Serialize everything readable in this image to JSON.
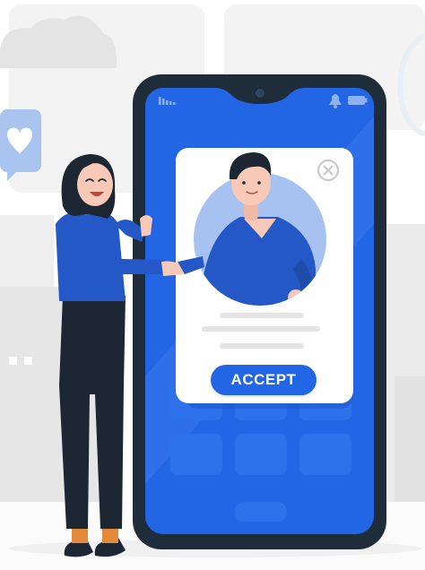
{
  "colors": {
    "accent": "#2266e6",
    "phone_frame": "#1f2c3a",
    "card": "#ffffff",
    "sky": "#ececec"
  },
  "icons": {
    "signal": "signal-icon",
    "bell": "bell-icon",
    "battery": "battery-icon",
    "close": "close-icon"
  },
  "profile_card": {
    "accept_label": "ACCEPT"
  }
}
